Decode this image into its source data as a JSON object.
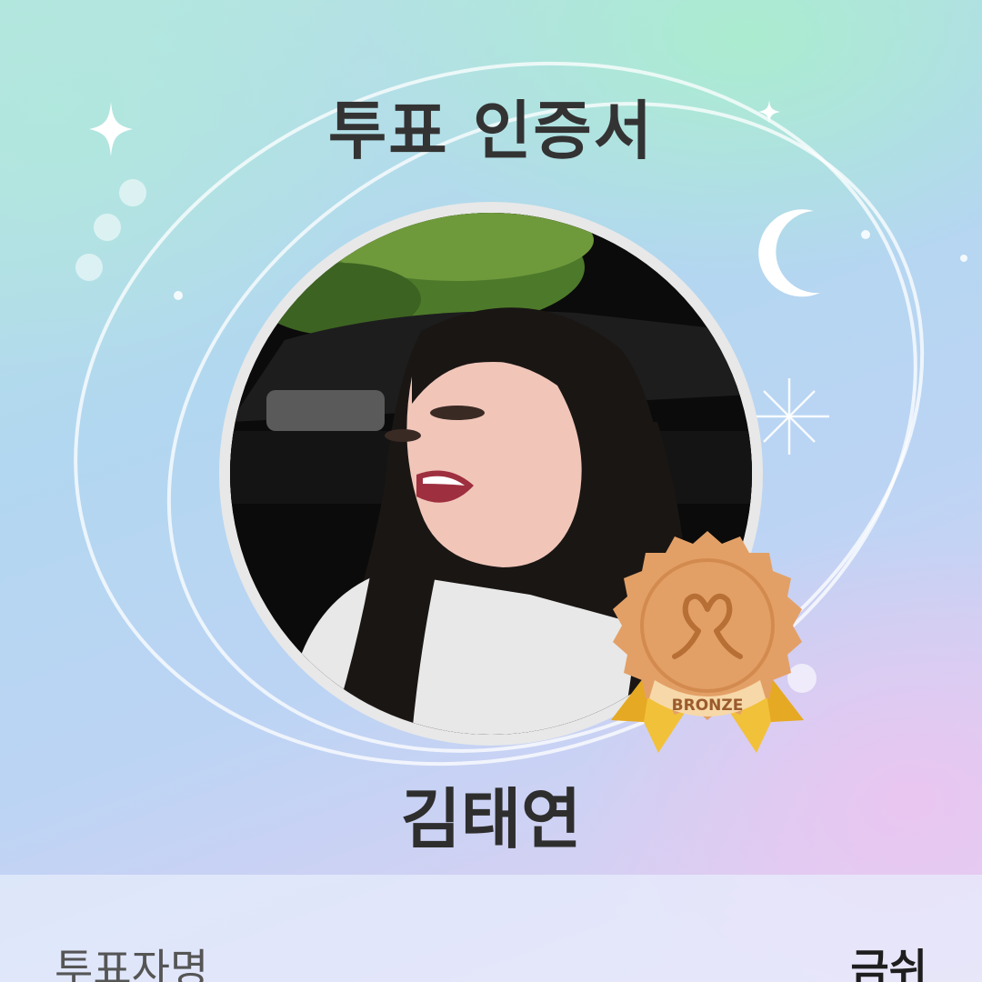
{
  "certificate": {
    "title": "투표 인증서",
    "name": "김태연",
    "badge": {
      "tier_label": "BRONZE",
      "color": "#d99a5b"
    }
  },
  "details": {
    "voter_label": "투표자명",
    "voter_value": "금쉬"
  },
  "icons": [
    "sparkle-icon",
    "moon-icon",
    "star-icon",
    "heart-icon",
    "medal-badge-icon"
  ],
  "colors": {
    "title_text": "#333333",
    "bronze": "#d99a5b",
    "ribbon": "#f2c13a"
  }
}
